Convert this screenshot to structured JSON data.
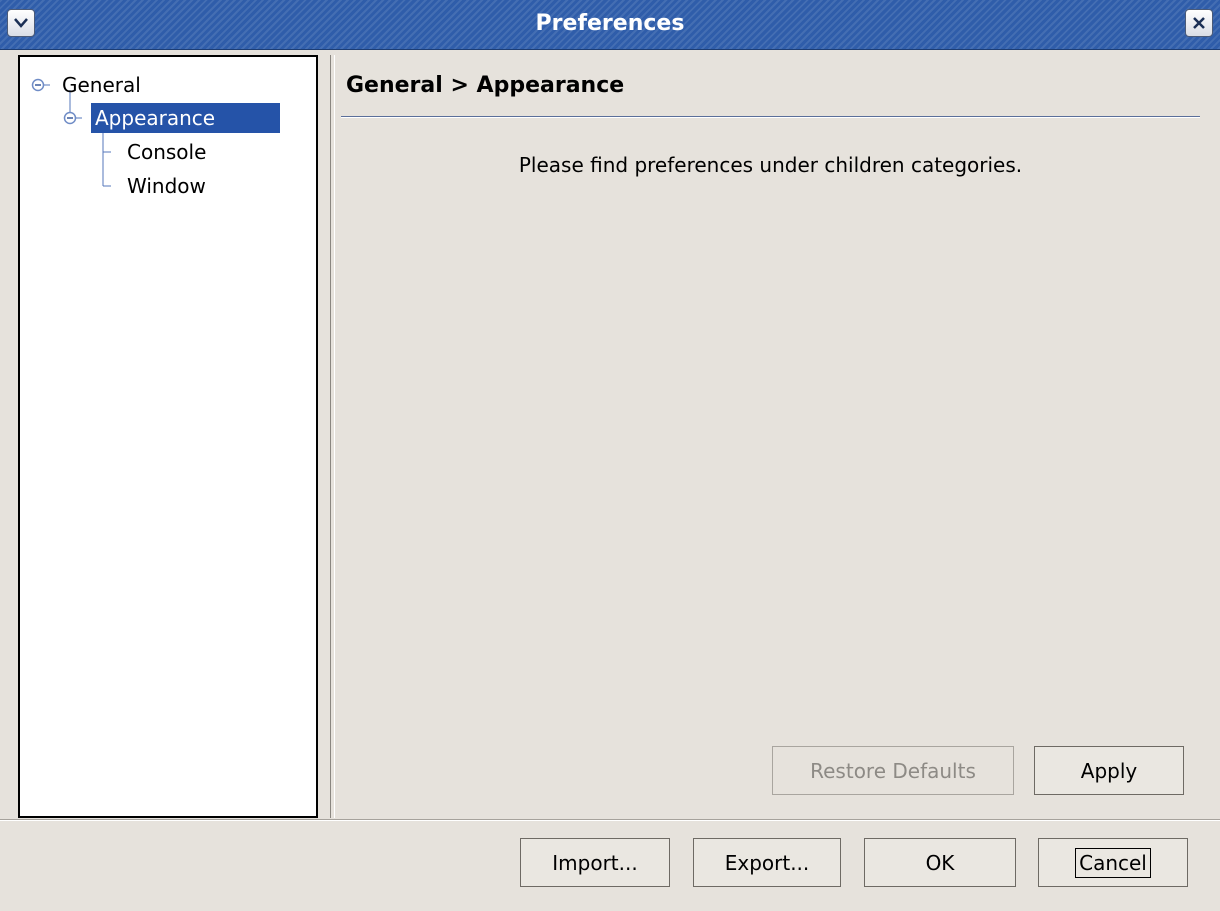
{
  "window": {
    "title": "Preferences",
    "menu_icon": "chevron-down-icon",
    "close_icon": "close-icon"
  },
  "tree": {
    "nodes": [
      {
        "label": "General",
        "expanded": true,
        "level": 0
      },
      {
        "label": "Appearance",
        "expanded": true,
        "level": 1,
        "selected": true
      },
      {
        "label": "Console",
        "level": 2
      },
      {
        "label": "Window",
        "level": 2
      }
    ]
  },
  "page": {
    "header": "General > Appearance",
    "message": "Please find preferences under children categories.",
    "restore_defaults_label": "Restore Defaults",
    "apply_label": "Apply"
  },
  "footer": {
    "import_label": "Import...",
    "export_label": "Export...",
    "ok_label": "OK",
    "cancel_label": "Cancel"
  },
  "colors": {
    "title_bar": "#2f5daa",
    "selection": "#2553a8",
    "background": "#e6e2dc",
    "tree_lines": "#5577bb"
  }
}
